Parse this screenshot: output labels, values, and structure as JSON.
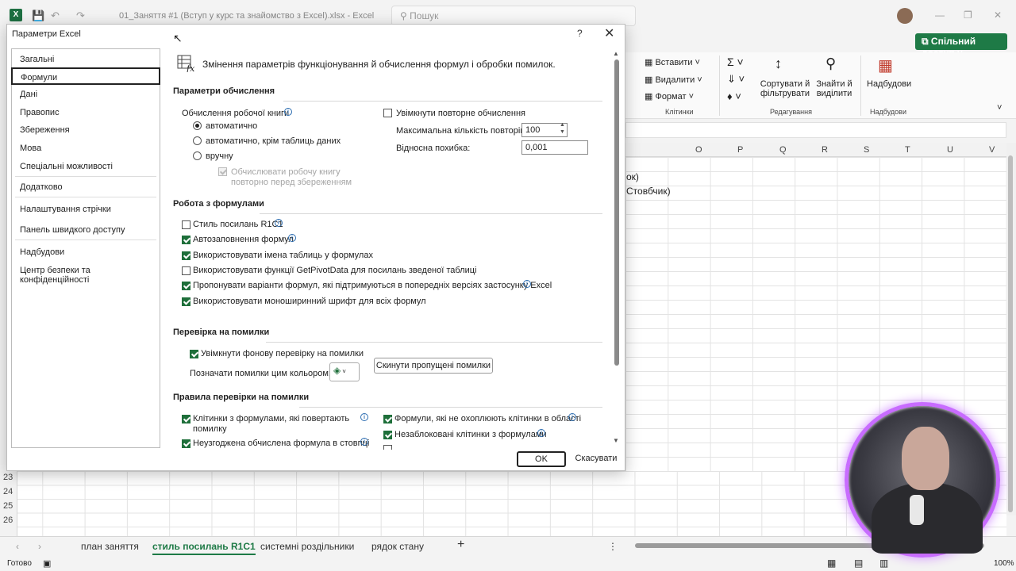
{
  "app": {
    "doc_title": "01_Заняття #1 (Вступ у курс та знайомство з Excel).xlsx  -  Excel",
    "search_placeholder": "Пошук",
    "share_label": "Спільний доступ"
  },
  "ribbon": {
    "insert": "Вставити",
    "delete": "Видалити",
    "format": "Формат",
    "cells_group": "Клітинки",
    "sort_filter": "Сортувати й фільтрувати",
    "find_select": "Знайти й виділити",
    "editing_group": "Редагування",
    "addins": "Надбудови",
    "addins_group": "Надбудови"
  },
  "columns": [
    "O",
    "P",
    "Q",
    "R",
    "S",
    "T",
    "U",
    "V"
  ],
  "cells": {
    "text1": "ок)",
    "text2": "Стовбчик)"
  },
  "rows": [
    "23",
    "24",
    "25",
    "26"
  ],
  "sheets": [
    "план заняття",
    "стиль посилань R1C1",
    "системні роздільники",
    "рядок стану"
  ],
  "status": {
    "ready": "Готово",
    "zoom": "100%"
  },
  "dialog": {
    "title": "Параметри Excel",
    "help": "?",
    "header": "Змінення параметрів функціонування й обчислення формул і обробки помилок.",
    "nav": [
      "Загальні",
      "Формули",
      "Дані",
      "Правопис",
      "Збереження",
      "Мова",
      "Спеціальні можливості",
      "Додатково",
      "Налаштування стрічки",
      "Панель швидкого доступу",
      "Надбудови",
      "Центр безпеки та конфіденційності"
    ],
    "calc": {
      "section": "Параметри обчислення",
      "workbook_calc": "Обчислення робочої книги",
      "auto": "автоматично",
      "auto_except": "автоматично, крім таблиць даних",
      "manual": "вручну",
      "recalc_before_save_1": "Обчислювати робочу книгу",
      "recalc_before_save_2": "повторно перед збереженням",
      "iterative": "Увімкнути повторне обчислення",
      "max_iter_label": "Максимальна кількість повторів:",
      "max_iter_value": "100",
      "max_change_label": "Відносна похибка:",
      "max_change_value": "0,001"
    },
    "formulas": {
      "section": "Робота з формулами",
      "items": [
        {
          "label": "Стиль посилань R1C1",
          "checked": false
        },
        {
          "label": "Автозаповнення формул",
          "checked": true
        },
        {
          "label": "Використовувати імена таблиць у формулах",
          "checked": true
        },
        {
          "label": "Використовувати функції GetPivotData для посилань зведеної таблиці",
          "checked": false
        },
        {
          "label": "Пропонувати варіанти формул, які підтримуються в попередніх версіях застосунку Excel",
          "checked": true
        },
        {
          "label": "Використовувати моноширинний шрифт для всіх формул",
          "checked": true
        }
      ]
    },
    "errors": {
      "section": "Перевірка на помилки",
      "background": "Увімкнути фонову перевірку на помилки",
      "color_label": "Позначати помилки цим кольором:",
      "reset_button": "Скинути пропущені помилки"
    },
    "rules": {
      "section": "Правила перевірки на помилки",
      "left": [
        "Клітинки з формулами, які повертають",
        "помилку",
        "Неузгоджена обчислена формула в стовпці"
      ],
      "right": [
        "Формули, які не охоплюють клітинки в області",
        "Незаблоковані клітинки з формулами"
      ]
    },
    "ok": "OK",
    "cancel": "Скасувати"
  },
  "colors": {
    "excel_green": "#1e7a46",
    "info_blue": "#2b6cb0",
    "webcam_ring": "#c86cff"
  }
}
